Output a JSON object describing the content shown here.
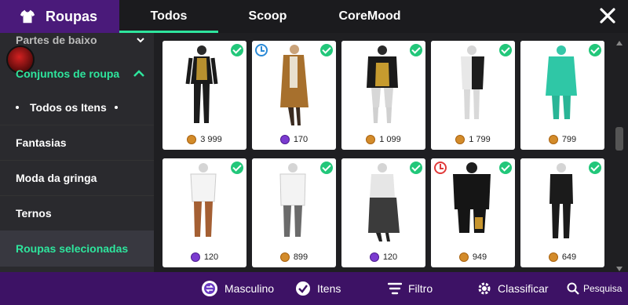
{
  "header": {
    "title": "Roupas",
    "tabs": [
      "Todos",
      "Scoop",
      "CoreMood"
    ],
    "active_tab": "Todos",
    "accent": "#2ee59d"
  },
  "sidebar": {
    "items": [
      {
        "label": "Partes de baixo"
      },
      {
        "label": "Conjuntos de roupa"
      },
      {
        "label": "Todos os Itens"
      },
      {
        "label": "Fantasias"
      },
      {
        "label": "Moda da gringa"
      },
      {
        "label": "Ternos"
      },
      {
        "label": "Roupas selecionadas"
      }
    ]
  },
  "grid": {
    "items": [
      {
        "price": "3 999",
        "currency": "coin",
        "owned": true,
        "timer": false
      },
      {
        "price": "170",
        "currency": "gem",
        "owned": true,
        "timer": "blue"
      },
      {
        "price": "1 099",
        "currency": "coin",
        "owned": true,
        "timer": false
      },
      {
        "price": "1 799",
        "currency": "coin",
        "owned": true,
        "timer": false
      },
      {
        "price": "799",
        "currency": "coin",
        "owned": true,
        "timer": false
      },
      {
        "price": "120",
        "currency": "gem",
        "owned": true,
        "timer": false
      },
      {
        "price": "899",
        "currency": "coin",
        "owned": true,
        "timer": false
      },
      {
        "price": "120",
        "currency": "gem",
        "owned": true,
        "timer": false
      },
      {
        "price": "949",
        "currency": "coin",
        "owned": true,
        "timer": "red"
      },
      {
        "price": "649",
        "currency": "coin",
        "owned": true,
        "timer": false
      }
    ]
  },
  "bottom": {
    "gender": "Masculino",
    "items": "Itens",
    "filter": "Filtro",
    "sort": "Classificar",
    "search": "Pesquisa"
  }
}
